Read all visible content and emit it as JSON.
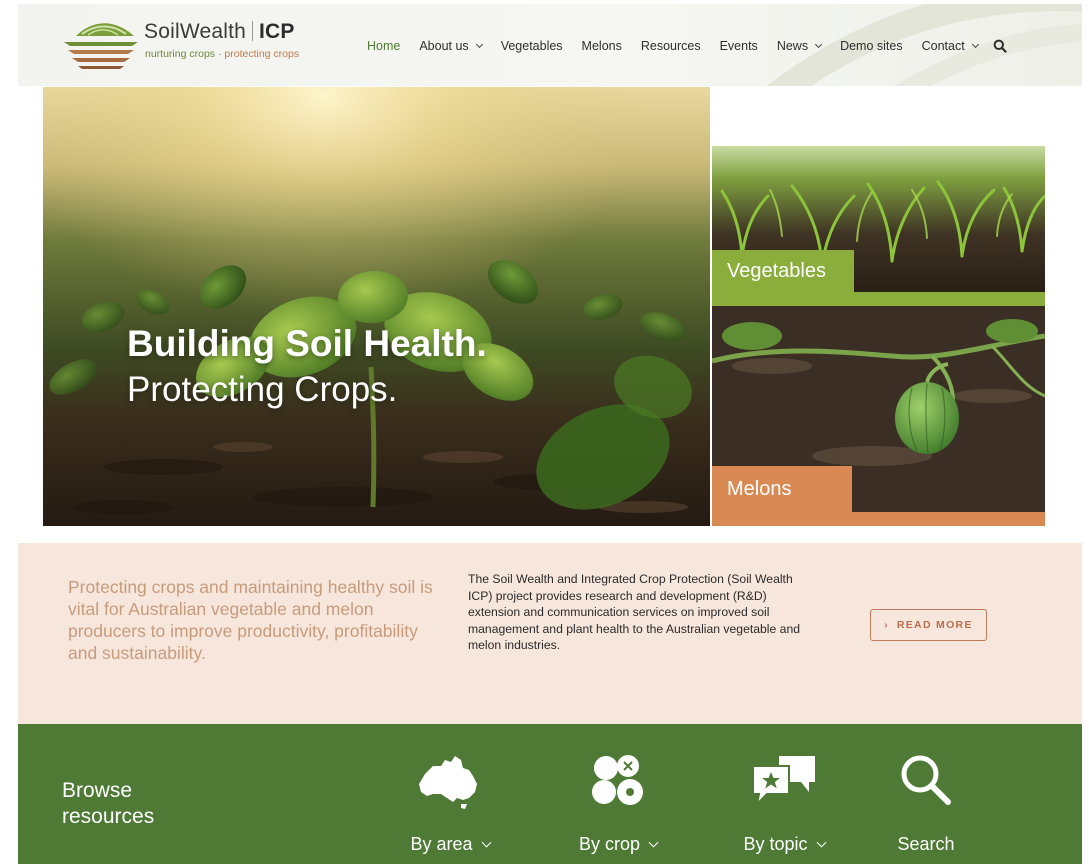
{
  "brand": {
    "name": "SoilWealth",
    "suffix": "ICP",
    "tagline_left": "nurturing crops",
    "tagline_sep": " · ",
    "tagline_right": "protecting crops"
  },
  "nav": {
    "items": [
      {
        "label": "Home",
        "active": true,
        "dropdown": false
      },
      {
        "label": "About us",
        "active": false,
        "dropdown": true
      },
      {
        "label": "Vegetables",
        "active": false,
        "dropdown": false
      },
      {
        "label": "Melons",
        "active": false,
        "dropdown": false
      },
      {
        "label": "Resources",
        "active": false,
        "dropdown": false
      },
      {
        "label": "Events",
        "active": false,
        "dropdown": false
      },
      {
        "label": "News",
        "active": false,
        "dropdown": true
      },
      {
        "label": "Demo sites",
        "active": false,
        "dropdown": false
      },
      {
        "label": "Contact",
        "active": false,
        "dropdown": true
      }
    ],
    "search_icon": "search-icon"
  },
  "hero": {
    "headline": "Building Soil Health.",
    "subheadline": "Protecting Crops."
  },
  "tiles": {
    "vegetables": {
      "label": "Vegetables",
      "color": "#8aad3b"
    },
    "melons": {
      "label": "Melons",
      "color": "#d98a54"
    }
  },
  "intro": {
    "lead": "Protecting crops and maintaining healthy soil is vital for Australian vegetable and melon producers to improve productivity, profitability and sustainability.",
    "body": "The Soil Wealth and Integrated Crop Protection (Soil Wealth ICP) project provides research and development (R&D) extension and communication services on improved soil management and plant health to the Australian vegetable and melon industries.",
    "read_more": "READ MORE",
    "read_more_arrow": "›"
  },
  "browse": {
    "title_line1": "Browse",
    "title_line2": "resources",
    "items": [
      {
        "label": "By area",
        "icon": "australia-map-icon",
        "dropdown": true
      },
      {
        "label": "By crop",
        "icon": "crop-produce-icon",
        "dropdown": true
      },
      {
        "label": "By topic",
        "icon": "topic-chat-icon",
        "dropdown": true
      },
      {
        "label": "Search",
        "icon": "search-icon",
        "dropdown": false
      }
    ]
  },
  "colors": {
    "accent_green": "#4f7b33",
    "browse_bg": "#4e7a35",
    "intro_bg": "#f7e6dc",
    "veg_green": "#8aad3b",
    "melon_orange": "#d98a54"
  }
}
